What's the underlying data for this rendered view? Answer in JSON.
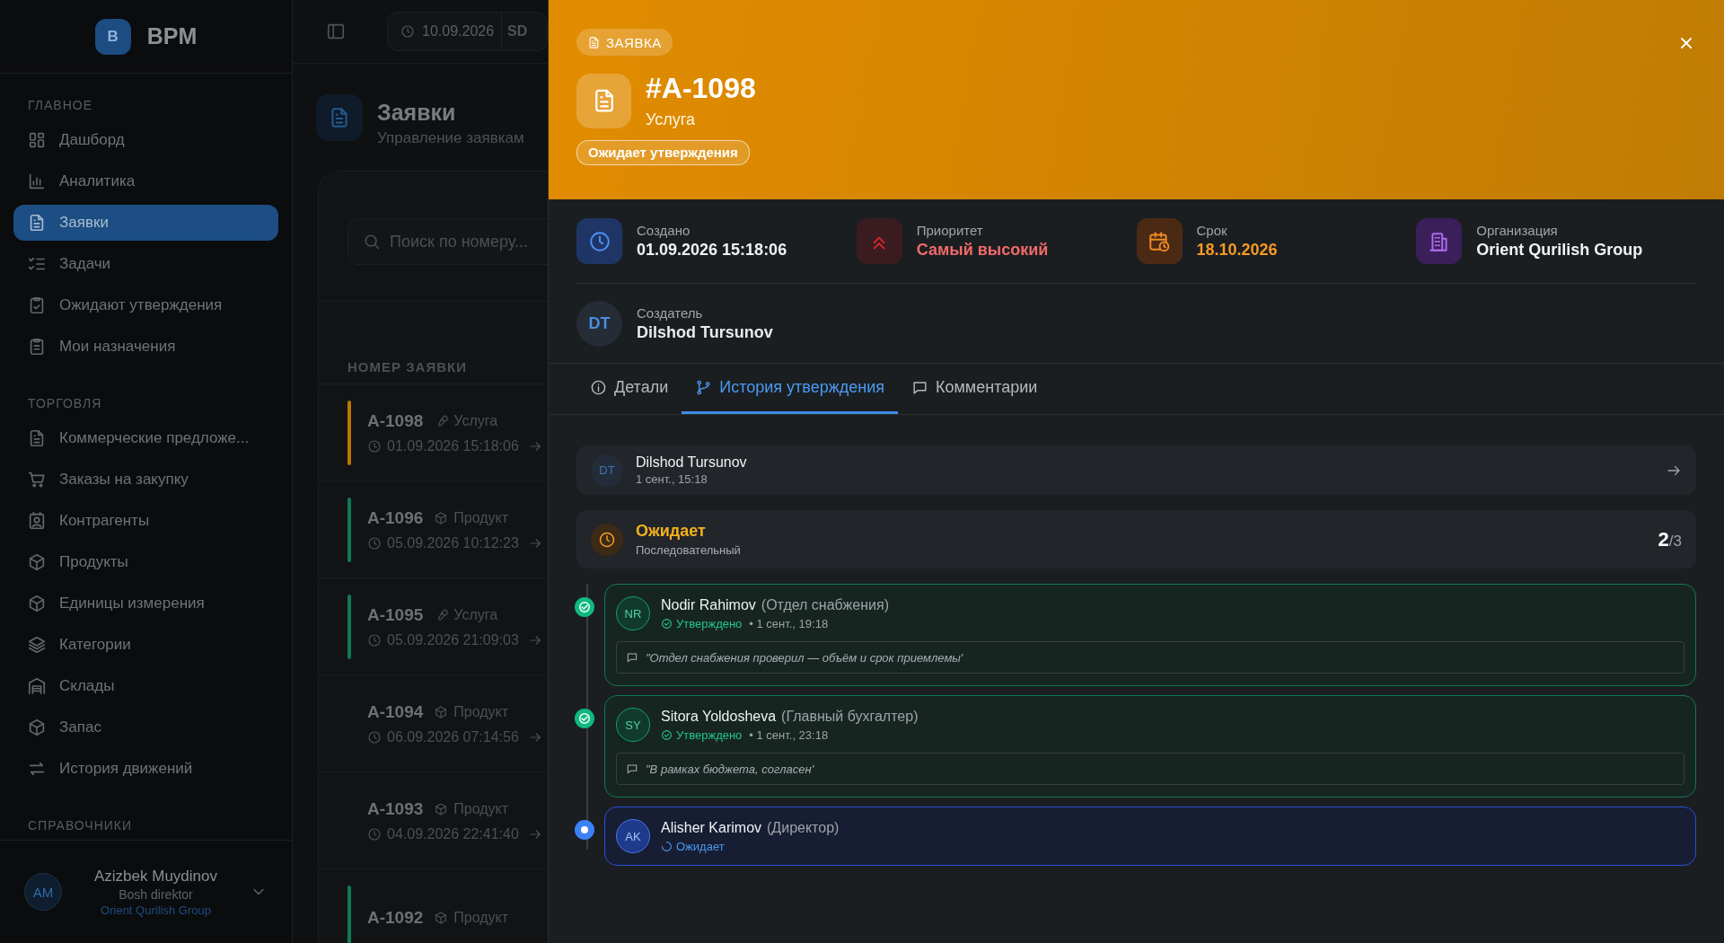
{
  "sidebar": {
    "logo": {
      "letter": "B",
      "name": "BPM"
    },
    "sections": [
      {
        "title": "ГЛАВНОЕ",
        "items": [
          {
            "label": "Дашборд",
            "selected": false
          },
          {
            "label": "Аналитика",
            "selected": false
          },
          {
            "label": "Заявки",
            "selected": true
          },
          {
            "label": "Задачи",
            "selected": false
          },
          {
            "label": "Ожидают утверждения",
            "selected": false
          },
          {
            "label": "Мои назначения",
            "selected": false
          }
        ]
      },
      {
        "title": "ТОРГОВЛЯ",
        "items": [
          {
            "label": "Коммерческие предложе...",
            "selected": false
          },
          {
            "label": "Заказы на закупку",
            "selected": false
          },
          {
            "label": "Контрагенты",
            "selected": false
          },
          {
            "label": "Продукты",
            "selected": false
          },
          {
            "label": "Единицы измерения",
            "selected": false
          },
          {
            "label": "Категории",
            "selected": false
          },
          {
            "label": "Склады",
            "selected": false
          },
          {
            "label": "Запас",
            "selected": false
          },
          {
            "label": "История движений",
            "selected": false
          }
        ]
      },
      {
        "title": "СПРАВОЧНИКИ"
      }
    ],
    "user": {
      "initials": "AM",
      "name": "Azizbek Muydinov",
      "role": "Bosh direktor",
      "org": "Orient Qurilish Group"
    }
  },
  "topbar": {
    "date": "10.09.2026",
    "currency": "SD"
  },
  "page": {
    "title": "Заявки",
    "subtitle": "Управление заявкам",
    "search": {
      "placeholder": "Поиск по номеру..."
    },
    "column": "НОМЕР ЗАЯВКИ",
    "rows": [
      {
        "number": "A-1098",
        "kind": "service",
        "type": "Услуга",
        "date": "01.09.2026 15:18:06",
        "color": "#b87708"
      },
      {
        "number": "A-1096",
        "kind": "product",
        "type": "Продукт",
        "date": "05.09.2026 10:12:23",
        "color": "#0f7a55"
      },
      {
        "number": "A-1095",
        "kind": "service",
        "type": "Услуга",
        "date": "05.09.2026 21:09:03",
        "color": "#0f7a55"
      },
      {
        "number": "A-1094",
        "kind": "product",
        "type": "Продукт",
        "date": "06.09.2026 07:14:56"
      },
      {
        "number": "A-1093",
        "kind": "product",
        "type": "Продукт",
        "date": "04.09.2026 22:41:40"
      },
      {
        "number": "A-1092",
        "kind": "product",
        "type": "Продукт",
        "color": "#0f7a55"
      }
    ]
  },
  "drawer": {
    "badge": "ЗАЯВКА",
    "title": "#A-1098",
    "type": "Услуга",
    "status": "Ожидает утверждения",
    "info": [
      {
        "kind": "created",
        "label": "Создано",
        "value": "01.09.2026 15:18:06"
      },
      {
        "kind": "priority",
        "label": "Приоритет",
        "value": "Самый высокий"
      },
      {
        "kind": "due",
        "label": "Срок",
        "value": "18.10.2026"
      },
      {
        "kind": "org",
        "label": "Организация",
        "value": "Orient Qurilish Group"
      }
    ],
    "creator": {
      "initials": "DT",
      "label": "Создатель",
      "name": "Dilshod Tursunov"
    },
    "tabs": [
      {
        "label": "Детали",
        "selected": false
      },
      {
        "label": "История утверждения",
        "selected": true
      },
      {
        "label": "Комментарии",
        "selected": false
      }
    ],
    "submitter": {
      "initials": "DT",
      "name": "Dilshod Tursunov",
      "time": "1 сент., 15:18"
    },
    "stage": {
      "status": "Ожидает",
      "mode": "Последовательный",
      "current": "2",
      "total": "/3"
    },
    "steps": [
      {
        "kind": "approved",
        "initials": "NR",
        "name": "Nodir Rahimov",
        "role": "(Отдел снабжения)",
        "status": "Утверждено",
        "time": "• 1 сент., 19:18",
        "comment": "\"Отдел снабжения проверил — объём и срок приемлемы'"
      },
      {
        "kind": "approved",
        "initials": "SY",
        "name": "Sitora Yoldosheva",
        "role": "(Главный бухгалтер)",
        "status": "Утверждено",
        "time": "• 1 сент., 23:18",
        "comment": "\"В рамках бюджета, согласен'"
      },
      {
        "kind": "pending",
        "initials": "AK",
        "name": "Alisher Karimov",
        "role": "(Директор)",
        "status": "Ожидает"
      }
    ]
  }
}
